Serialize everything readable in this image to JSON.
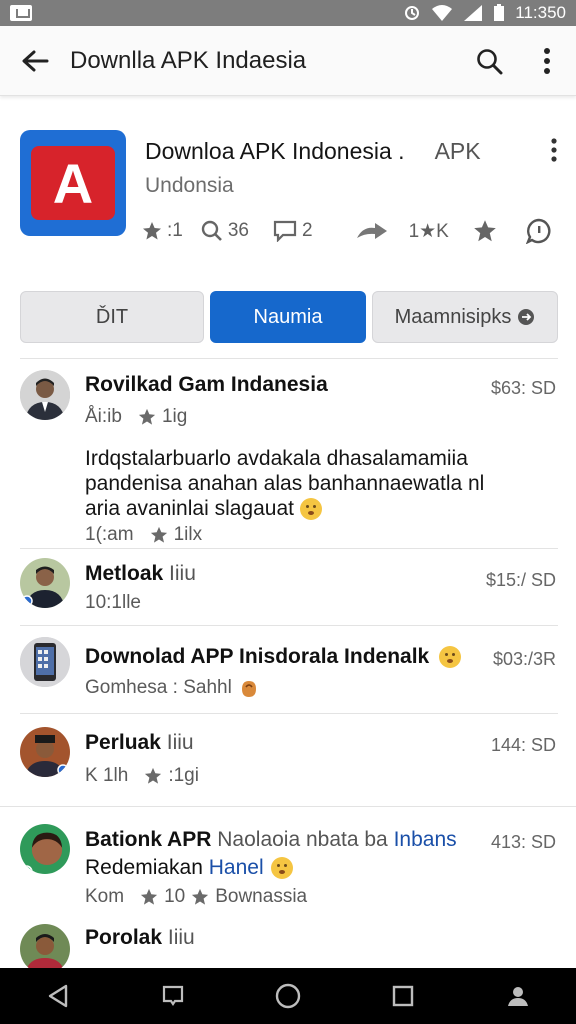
{
  "status_bar": {
    "time": "11:350"
  },
  "app_bar": {
    "title": "Downlla APK Indaesia"
  },
  "app": {
    "title": "Downloa APK Indonesia .",
    "tag": "APK",
    "subtitle": "Undonsia",
    "stats": [
      {
        "icon": "star-icon",
        "value": ":1"
      },
      {
        "icon": "search-icon",
        "value": "36"
      },
      {
        "icon": "comment-icon",
        "value": "2"
      },
      {
        "icon": "share-icon",
        "value": ""
      },
      {
        "icon": "star-icon",
        "value": "1★K"
      },
      {
        "icon": "star-icon",
        "value": ""
      },
      {
        "icon": "chat-icon",
        "value": ""
      }
    ]
  },
  "tabs": [
    {
      "label": "ĎIT"
    },
    {
      "label": "Naumia"
    },
    {
      "label": "Maamnisipks"
    }
  ],
  "posts": [
    {
      "name": "Rovilkad Gam Indanesia",
      "time": "$63: SD",
      "meta1": "Åi:ib",
      "meta2": "1ig",
      "body": "Irdqstalarbuarlo avdakala dhasalamamiia pandenisa anahan alas banhannaewatla nl aria avaninlai slagauat",
      "foot1": "1(:am",
      "foot2": "1ilx"
    },
    {
      "name": "Metloak",
      "name_light": "Iiiu",
      "time": "$15:/ SD",
      "meta1": "10:1lle"
    },
    {
      "name": "Downolad APP Inisdorala Indenalk",
      "time": "$03:/3R",
      "meta1": "Gomhesa : Sahhl"
    },
    {
      "name": "Perluak",
      "name_light": "Iiiu",
      "time": "144: SD",
      "meta1": "K 1lh",
      "meta2": ":1gi"
    },
    {
      "name": "Bationk APR",
      "name_light": "Naolaoia nbata ba",
      "name_blue": "Inbans",
      "line2": "Redemiakan",
      "line2_blue": "Hanel",
      "time": "413: SD",
      "meta1": "Kom",
      "meta2": "10",
      "meta3": "Bownassia"
    },
    {
      "name": "Porolak",
      "name_light": "Iiiu"
    }
  ]
}
